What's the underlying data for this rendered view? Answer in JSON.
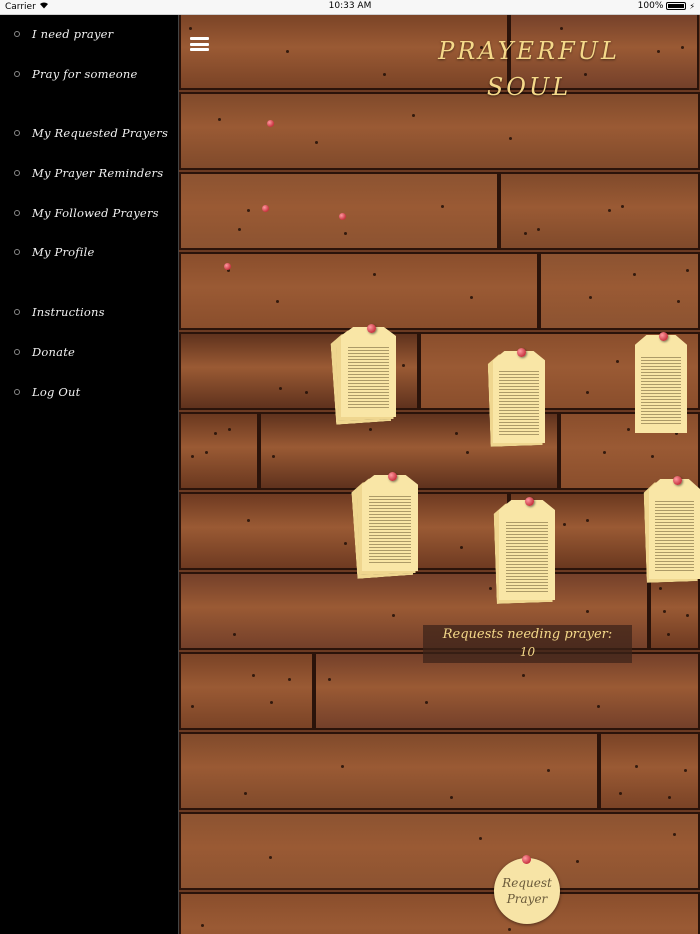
{
  "status_bar": {
    "carrier": "Carrier",
    "time": "10:33 AM",
    "battery": "100%"
  },
  "sidebar": {
    "items": [
      {
        "label": "I need prayer"
      },
      {
        "label": "Pray for someone"
      },
      {
        "label": "My Requested Prayers"
      },
      {
        "label": "My Prayer Reminders"
      },
      {
        "label": "My Followed Prayers"
      },
      {
        "label": "My Profile"
      },
      {
        "label": "Instructions"
      },
      {
        "label": "Donate"
      },
      {
        "label": "Log Out"
      }
    ]
  },
  "header": {
    "title_line1": "PRAYERFUL",
    "title_line2": "SOUL"
  },
  "board": {
    "requests_label": "Requests needing prayer:",
    "requests_count": "10"
  },
  "request_button": {
    "label": "Request Prayer"
  },
  "colors": {
    "title": "#f5d98a",
    "paper": "#f9e6a6",
    "pin": "#c8323f",
    "wood": "#6b3a22"
  }
}
